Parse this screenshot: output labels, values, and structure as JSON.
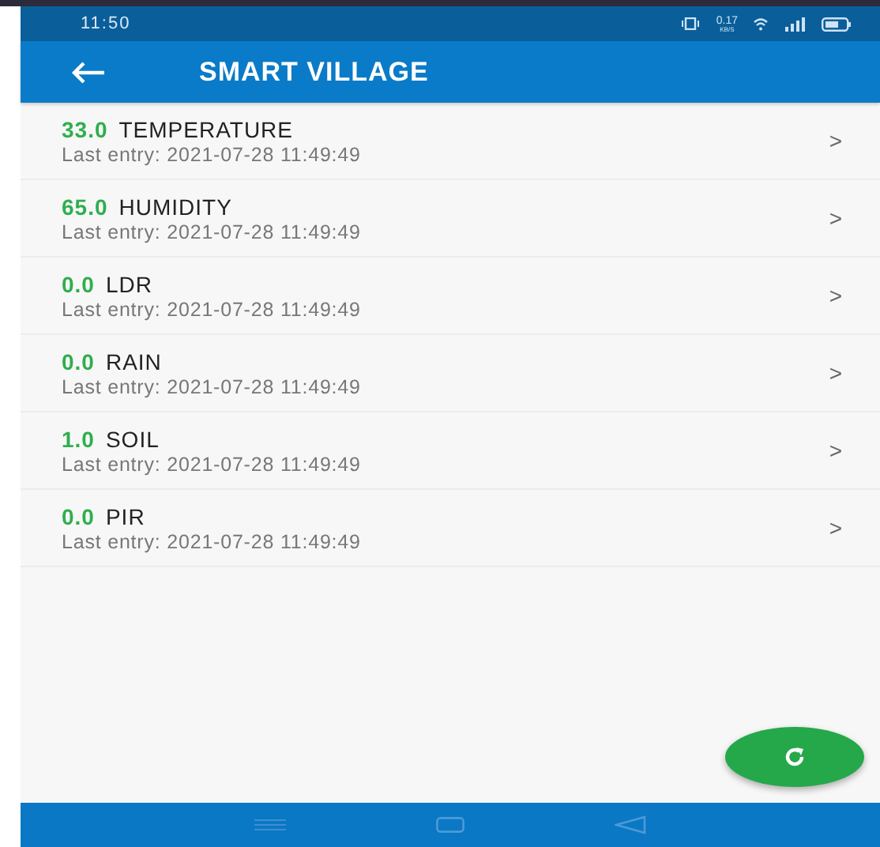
{
  "status_bar": {
    "time": "11:50",
    "net_speed": "0.17",
    "net_unit": "KB/S"
  },
  "app_bar": {
    "title": "SMART VILLAGE"
  },
  "sensors": [
    {
      "value": "33.0",
      "name": "TEMPERATURE",
      "last_entry": "Last entry: 2021-07-28 11:49:49",
      "chevron": ">"
    },
    {
      "value": "65.0",
      "name": "HUMIDITY",
      "last_entry": "Last entry: 2021-07-28 11:49:49",
      "chevron": ">"
    },
    {
      "value": "0.0",
      "name": "LDR",
      "last_entry": "Last entry: 2021-07-28 11:49:49",
      "chevron": ">"
    },
    {
      "value": "0.0",
      "name": "RAIN",
      "last_entry": "Last entry: 2021-07-28 11:49:49",
      "chevron": ">"
    },
    {
      "value": "1.0",
      "name": "SOIL",
      "last_entry": "Last entry: 2021-07-28 11:49:49",
      "chevron": ">"
    },
    {
      "value": "0.0",
      "name": "PIR",
      "last_entry": "Last entry: 2021-07-28 11:49:49",
      "chevron": ">"
    }
  ]
}
